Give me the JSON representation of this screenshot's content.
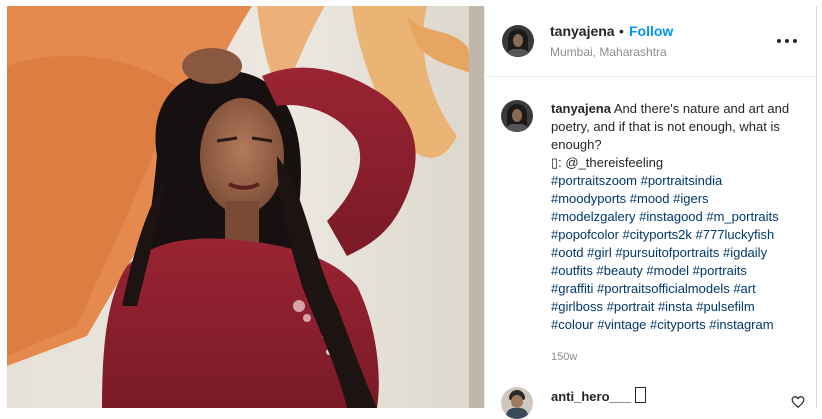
{
  "post": {
    "username": "tanyajena",
    "separator": "•",
    "follow_label": "Follow",
    "location": "Mumbai, Maharashtra"
  },
  "caption": {
    "username": "tanyajena",
    "text": "And there's nature and art and poetry, and if that is not enough, what is enough?",
    "credit": "▯: @_thereisfeeling",
    "hashtags": [
      "#portraitszoom #portraitsindia",
      "#moodyports #mood #igers",
      "#modelzgalery #instagood #m_portraits",
      "#popofcolor #cityports2k #777luckyfish",
      "#ootd #girl #pursuitofportraits #igdaily",
      "#outfits #beauty #model #portraits",
      "#graffiti #portraitsofficialmodels #art",
      "#girlboss #portrait #insta #pulsefilm",
      "#colour #vintage #cityports #instagram"
    ],
    "timestamp": "150w"
  },
  "comment": {
    "username": "anti_hero___"
  },
  "icons": {
    "more": "more-options-icon",
    "like": "heart-icon"
  },
  "colors": {
    "link_blue": "#0095f6",
    "hashtag": "#00376b",
    "muted": "#8e8e8e"
  }
}
